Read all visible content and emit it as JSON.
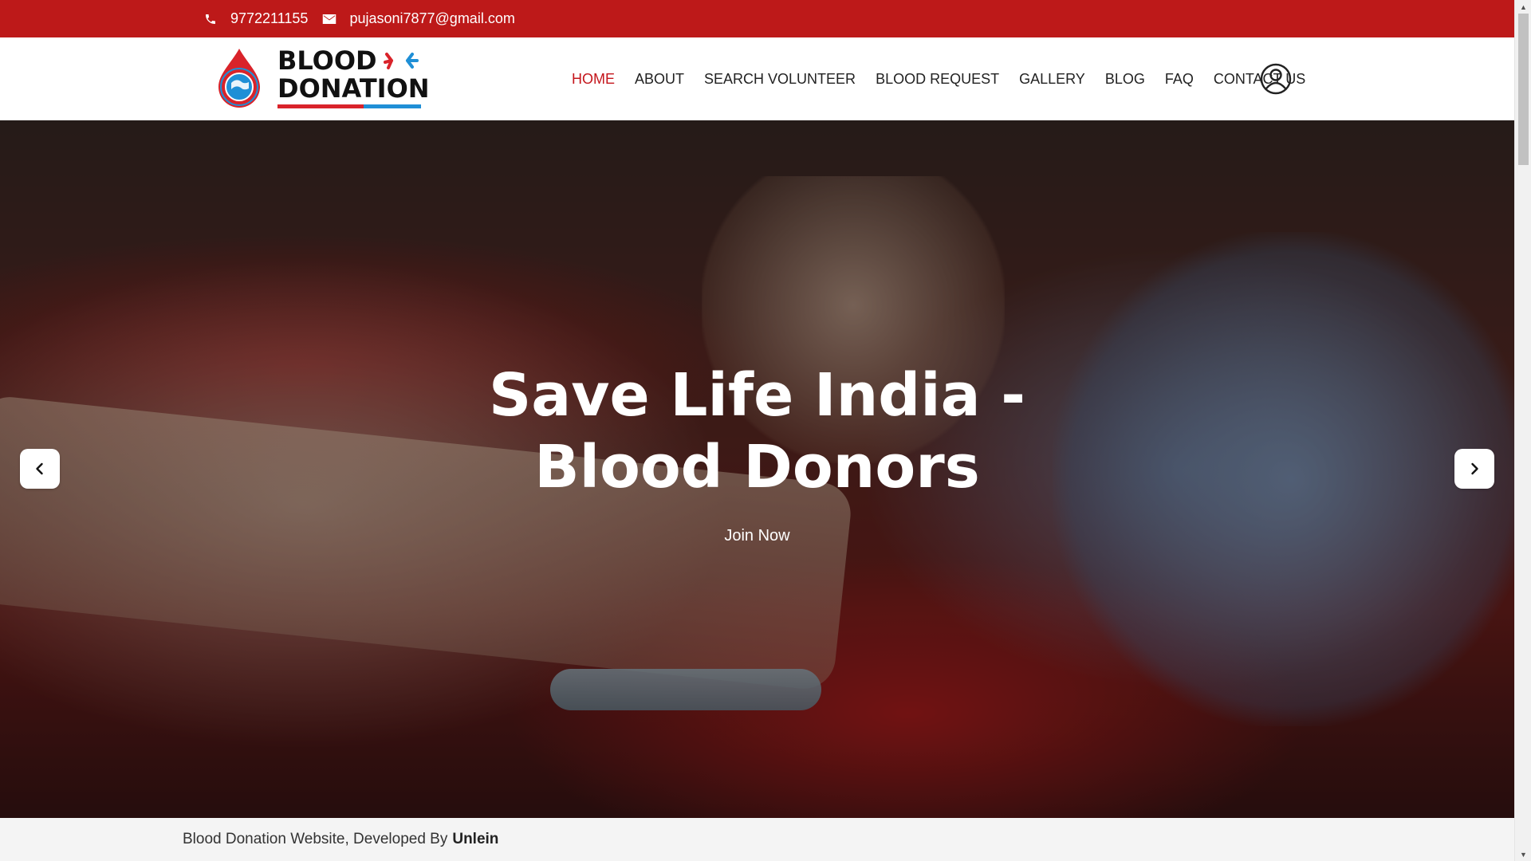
{
  "topbar": {
    "phone": "9772211155",
    "email": "pujasoni7877@gmail.com",
    "bg_color": "#bd1919"
  },
  "logo": {
    "line1": "BLOOD",
    "line2": "DONATION",
    "badge_text": "BLOOD DONATION",
    "icon": "blood-drop-globe-icon"
  },
  "nav": {
    "items": [
      {
        "label": "HOME",
        "active": true
      },
      {
        "label": "ABOUT"
      },
      {
        "label": "SEARCH VOLUNTEER"
      },
      {
        "label": "BLOOD REQUEST"
      },
      {
        "label": "GALLERY"
      },
      {
        "label": "BLOG"
      },
      {
        "label": "FAQ"
      },
      {
        "label": "CONTACT US"
      }
    ],
    "active_color": "#c4161c",
    "user_icon": "user-account-icon"
  },
  "hero": {
    "title": "Save Life India - Blood Donors",
    "cta": "Join Now",
    "prev_icon": "chevron-left-icon",
    "next_icon": "chevron-right-icon"
  },
  "footer": {
    "text": "Blood Donation Website, Developed By",
    "developer": "Unlein"
  }
}
